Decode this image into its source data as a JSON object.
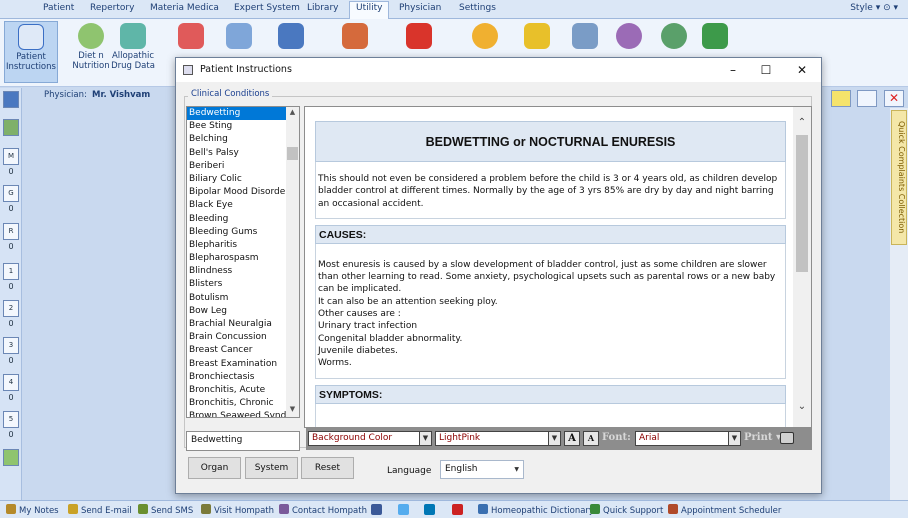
{
  "menu": {
    "items": [
      "Patient",
      "Repertory",
      "Materia Medica",
      "Expert System",
      "Library",
      "Utility",
      "Physician",
      "Settings"
    ],
    "active": "Utility",
    "style_label": "Style"
  },
  "ribbon": {
    "items": [
      {
        "label": "Patient Instructions",
        "icon": "patient-instructions-icon",
        "color": "#3b6fc5",
        "selected": true
      },
      {
        "label": "Diet n Nutrition",
        "icon": "apple-icon",
        "color": "#6aa84f"
      },
      {
        "label": "Allopathic Drug Data",
        "icon": "capsule-icon",
        "color": "#3a9a8c"
      }
    ]
  },
  "physician": {
    "label": "Physician:",
    "name": "Mr. Vishvam"
  },
  "left_strip": {
    "buttons": [
      {
        "label": "M",
        "count": "0"
      },
      {
        "label": "G",
        "count": "0"
      },
      {
        "label": "R",
        "count": "0"
      },
      {
        "label": "1",
        "count": "0"
      },
      {
        "label": "2",
        "count": "0"
      },
      {
        "label": "3",
        "count": "0"
      },
      {
        "label": "4",
        "count": "0"
      },
      {
        "label": "5",
        "count": "0"
      }
    ]
  },
  "right_panel": {
    "label": "Quick Complaints Collection"
  },
  "dialog": {
    "title": "Patient Instructions",
    "group_label": "Clinical Conditions",
    "conditions": [
      "Bedwetting",
      "Bee Sting",
      "Belching",
      "Bell's Palsy",
      "Beriberi",
      "Biliary Colic",
      "Bipolar Mood Disorder",
      "Black Eye",
      "Bleeding",
      "Bleeding Gums",
      "Blepharitis",
      "Blepharospasm",
      "Blindness",
      "Blisters",
      "Botulism",
      "Bow Leg",
      "Brachial Neuralgia",
      "Brain Concussion",
      "Breast Cancer",
      "Breast Examination",
      "Bronchiectasis",
      "Bronchitis, Acute",
      "Bronchitis, Chronic",
      "Brown Seaweed Syndrome"
    ],
    "selected_condition": "Bedwetting",
    "search_value": "Bedwetting",
    "document": {
      "title": "BEDWETTING or NOCTURNAL ENURESIS",
      "intro": "This should not even be considered a problem before the child is 3 or 4 years old, as children develop bladder control at different times. Normally by the age of 3 yrs 85% are dry by day and night barring an occasional accident.",
      "causes_heading": "CAUSES:",
      "causes_text": "Most enuresis is caused by a slow development of bladder control, just as some children are slower than other learning to read. Some anxiety, psychological upsets such as parental rows or a new baby can be implicated.\nIt can also be an attention seeking ploy.\nOther causes are :\nUrinary tract infection\nCongenital bladder abnormality.\nJuvenile diabetes.\nWorms.",
      "symptoms_heading": "SYMPTOMS:"
    },
    "toolbar": {
      "color_target": "Background Color",
      "color_value": "LightPink",
      "font_label": "Font:",
      "font_value": "Arial",
      "print_label": "Print"
    },
    "buttons": {
      "organ": "Organ",
      "system": "System",
      "reset": "Reset"
    },
    "language": {
      "label": "Language",
      "value": "English"
    }
  },
  "statusbar": {
    "items": [
      {
        "label": "My Notes",
        "color": "#b58a2a"
      },
      {
        "label": "Send E-mail",
        "color": "#c9a227"
      },
      {
        "label": "Send SMS",
        "color": "#6a8f2f"
      },
      {
        "label": "Visit Hompath",
        "color": "#7a7a3a"
      },
      {
        "label": "Contact Hompath",
        "color": "#7a5a9a"
      },
      {
        "label": "Homeopathic Dictionary",
        "color": "#3a6fb0"
      },
      {
        "label": "Quick Support",
        "color": "#3a8a3a"
      },
      {
        "label": "Appointment Scheduler",
        "color": "#b04a2a"
      }
    ]
  }
}
